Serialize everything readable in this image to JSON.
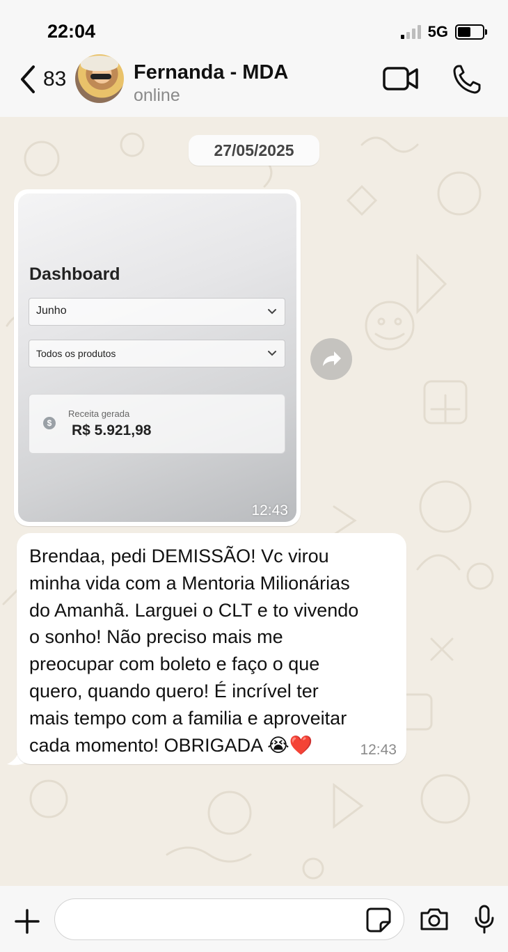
{
  "status_bar": {
    "time": "22:04",
    "network": "5G"
  },
  "header": {
    "back_count": "83",
    "contact_name": "Fernanda - MDA",
    "contact_status": "online"
  },
  "chat": {
    "date_chip": "27/05/2025",
    "image_message": {
      "dashboard_title": "Dashboard",
      "month_select": "Junho",
      "product_select": "Todos os produtos",
      "revenue_label": "Receita gerada",
      "revenue_value": "R$ 5.921,98",
      "time": "12:43"
    },
    "text_message": {
      "text": "Brendaa, pedi DEMISSÃO! Vc virou\nminha vida com a Mentoria Milionárias\ndo Amanhã. Larguei o CLT e to vivendo\no sonho! Não preciso mais me\npreocupar com boleto e faço o que\nquero, quando quero! É incrível ter\nmais tempo com a familia e aproveitar\ncada momento! OBRIGADA 😭❤️",
      "time": "12:43"
    }
  },
  "icons": {
    "back": "chevron-left-icon",
    "video": "video-camera-icon",
    "call": "phone-icon",
    "forward": "forward-arrow-icon",
    "plus": "plus-icon",
    "sticker": "sticker-icon",
    "camera": "camera-icon",
    "mic": "microphone-icon"
  },
  "colors": {
    "chat_background": "#f2ede4",
    "bubble": "#ffffff",
    "header_background": "#f7f7f7"
  }
}
